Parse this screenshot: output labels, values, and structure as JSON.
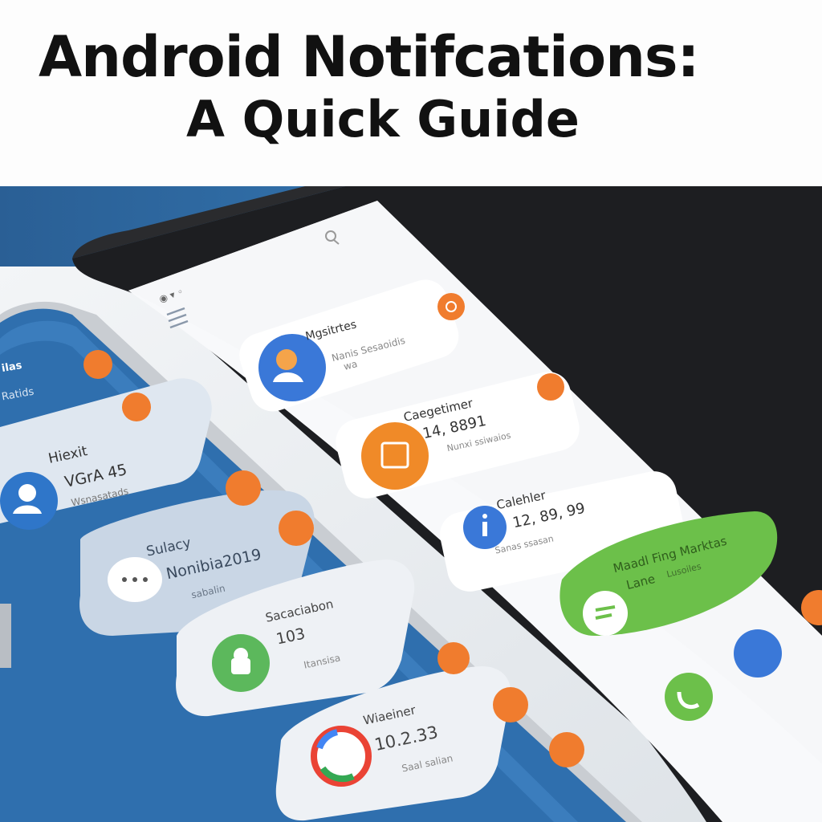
{
  "heading": {
    "line1": "Android Notifcations:",
    "line2": "A Quick Guide"
  },
  "back_phone": {
    "cards": [
      {
        "title": "Mgsitrtes",
        "sub": "Nanis Sesaoidis",
        "sub2": "wa",
        "icon": "person-icon",
        "icon_color": "#3a78d8",
        "badge_color": "#f07c2e"
      },
      {
        "title": "Caegetimer",
        "sub": "14, 8891",
        "sub2": "Nunxi ssiwaios",
        "icon": "calendar-icon",
        "icon_color": "#f08a28",
        "badge_color": "#f07c2e"
      },
      {
        "title": "Calehler",
        "sub": "12, 89, 99",
        "sub2": "Sanas ssasan",
        "icon": "info-icon",
        "icon_color": "#3a78d8",
        "badge_color": ""
      },
      {
        "title": "Maadl Fing Marktas",
        "sub": "Lane",
        "sub2": "Lusoiles",
        "icon": "chat-icon",
        "icon_color": "#5cb85c",
        "badge_color": ""
      }
    ]
  },
  "front_phone": {
    "header_label": "ilas",
    "header_sub": "Ratids",
    "cards": [
      {
        "title": "Hiexit",
        "sub": "VGrA 45",
        "sub2": "Wsnasatads",
        "icon": "person-icon",
        "icon_color": "#2f76c9"
      },
      {
        "title": "Sulacy",
        "sub": "Nonibia2019",
        "sub2": "sabalin",
        "icon": "chat-icon",
        "icon_color": "#ffffff"
      },
      {
        "title": "Sacaciabon",
        "sub": "103",
        "sub2": "Itansisa",
        "icon": "android-icon",
        "icon_color": "#5cb85c"
      },
      {
        "title": "Wiaeiner",
        "sub": "10.2.33",
        "sub2": "Saal salian",
        "icon": "google-icon",
        "icon_color": "#ea4335"
      }
    ]
  },
  "colors": {
    "accent_orange": "#f07c2e",
    "front_screen_blue": "#2f6fae",
    "green": "#6cc04a",
    "blue": "#3a78d8"
  }
}
